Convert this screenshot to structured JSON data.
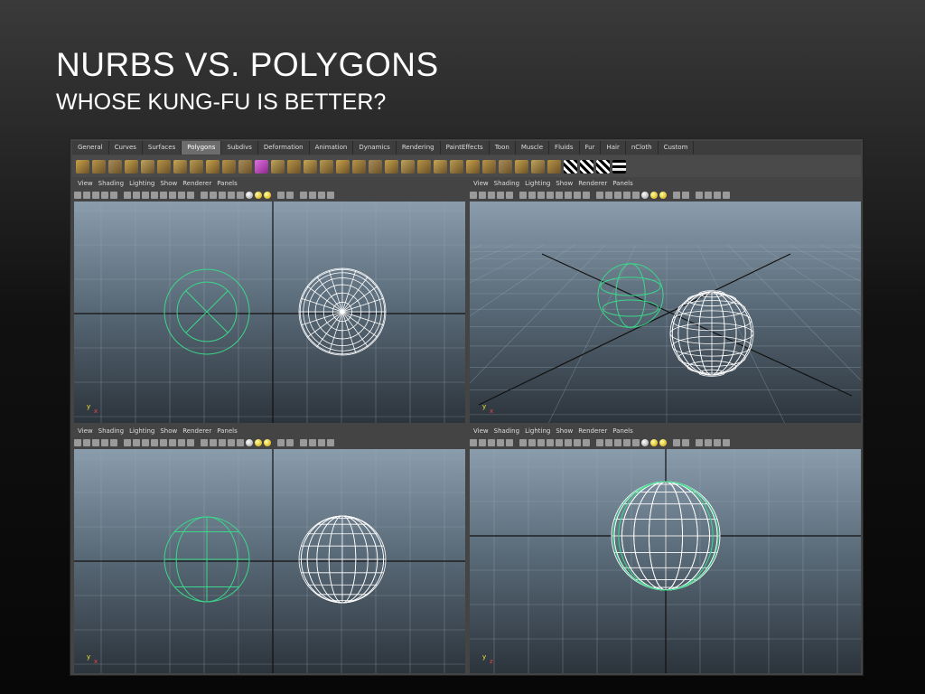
{
  "slide": {
    "title": "NURBS VS. POLYGONS",
    "subtitle": "WHOSE KUNG-FU IS BETTER?"
  },
  "shelf": {
    "tabs": [
      {
        "label": "General",
        "active": false
      },
      {
        "label": "Curves",
        "active": false
      },
      {
        "label": "Surfaces",
        "active": false
      },
      {
        "label": "Polygons",
        "active": true
      },
      {
        "label": "Subdivs",
        "active": false
      },
      {
        "label": "Deformation",
        "active": false
      },
      {
        "label": "Animation",
        "active": false
      },
      {
        "label": "Dynamics",
        "active": false
      },
      {
        "label": "Rendering",
        "active": false
      },
      {
        "label": "PaintEffects",
        "active": false
      },
      {
        "label": "Toon",
        "active": false
      },
      {
        "label": "Muscle",
        "active": false
      },
      {
        "label": "Fluids",
        "active": false
      },
      {
        "label": "Fur",
        "active": false
      },
      {
        "label": "Hair",
        "active": false
      },
      {
        "label": "nCloth",
        "active": false
      },
      {
        "label": "Custom",
        "active": false
      }
    ],
    "icons": [
      "poly-sphere-icon",
      "poly-cube-icon",
      "poly-cylinder-icon",
      "poly-cone-icon",
      "poly-plane-icon",
      "poly-torus-icon",
      "poly-prism-icon",
      "poly-pyramid-icon",
      "poly-pipe-icon",
      "poly-helix-icon",
      "poly-soccer-ball-icon",
      "poly-platonic-icon",
      "combine-icon",
      "separate-icon",
      "extract-icon",
      "bridge-icon",
      "smooth-icon",
      "mirror-icon",
      "extrude-icon",
      "bevel-icon",
      "wedge-icon",
      "append-icon",
      "split-icon",
      "insert-loop-icon",
      "cut-faces-icon",
      "merge-icon",
      "collapse-icon",
      "soften-icon",
      "harden-icon",
      "uv-layout-icon",
      "uv-planar-icon",
      "uv-cylindrical-icon",
      "uv-spherical-icon",
      "uv-editor-icon"
    ]
  },
  "panel_menu": [
    "View",
    "Shading",
    "Lighting",
    "Show",
    "Renderer",
    "Panels"
  ],
  "viewports": [
    {
      "name": "top",
      "axis_y": "y",
      "axis_x": "x"
    },
    {
      "name": "persp",
      "axis_y": "y",
      "axis_x": "x"
    },
    {
      "name": "front",
      "axis_y": "y",
      "axis_x": "x"
    },
    {
      "name": "side",
      "axis_y": "y",
      "axis_x": "z"
    }
  ],
  "colors": {
    "nurbs_wire": "#3ad88a",
    "poly_wire": "#ffffff",
    "grid": "#9aa8b4",
    "axis_line": "#111111"
  }
}
